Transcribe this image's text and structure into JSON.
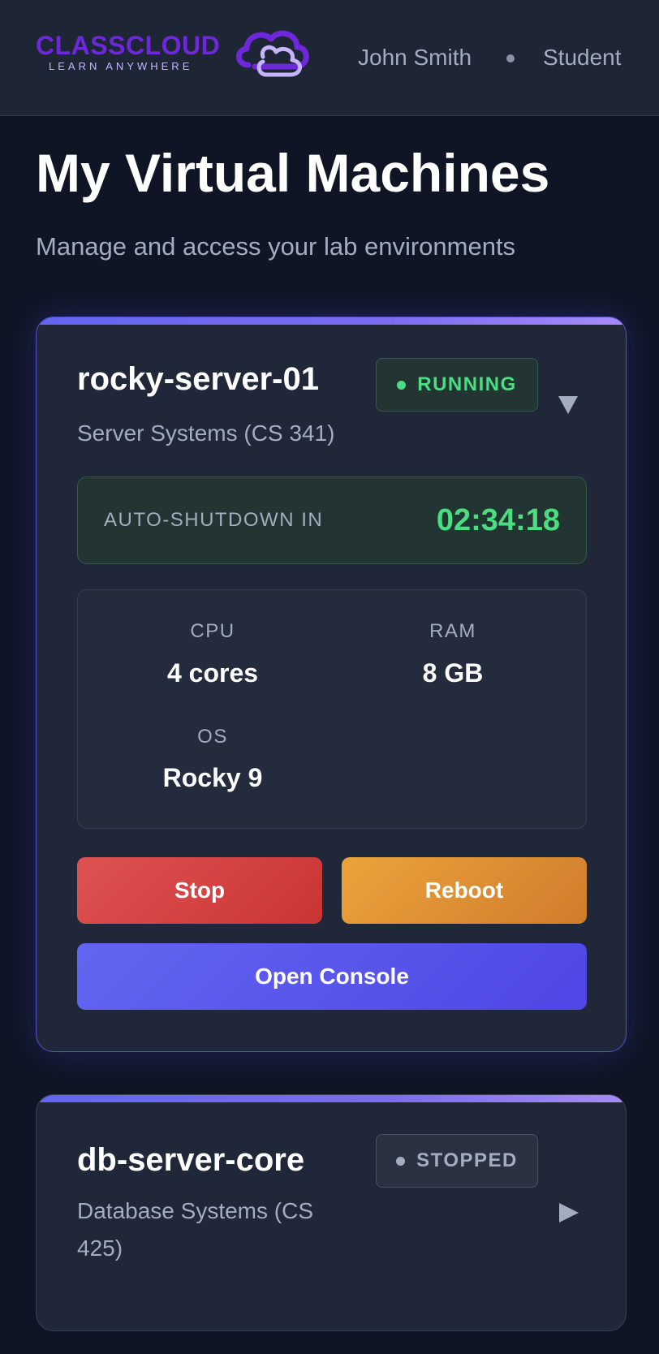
{
  "header": {
    "logo_title": "CLASSCLOUD",
    "logo_subtitle": "LEARN ANYWHERE",
    "user_name": "John Smith",
    "user_role": "Student"
  },
  "page": {
    "title": "My Virtual Machines",
    "subtitle": "Manage and access your lab environments"
  },
  "vms": [
    {
      "name": "rocky-server-01",
      "course": "Server Systems (CS 341)",
      "status": "RUNNING",
      "expanded": true,
      "toggle_icon": "chevron-down-icon",
      "shutdown_label": "AUTO-SHUTDOWN IN",
      "shutdown_time": "02:34:18",
      "specs": {
        "cpu_label": "CPU",
        "cpu_value": "4 cores",
        "ram_label": "RAM",
        "ram_value": "8 GB",
        "os_label": "OS",
        "os_value": "Rocky 9"
      },
      "actions": {
        "stop": "Stop",
        "reboot": "Reboot",
        "console": "Open Console"
      }
    },
    {
      "name": "db-server-core",
      "course": "Database Systems (CS 425)",
      "status": "STOPPED",
      "expanded": false,
      "toggle_icon": "chevron-right-icon"
    }
  ],
  "colors": {
    "accent": "#6366f1",
    "running": "#4ade80",
    "stop": "#d94444",
    "reboot": "#e08f33",
    "background": "#0f1524",
    "card": "#1f2738"
  }
}
